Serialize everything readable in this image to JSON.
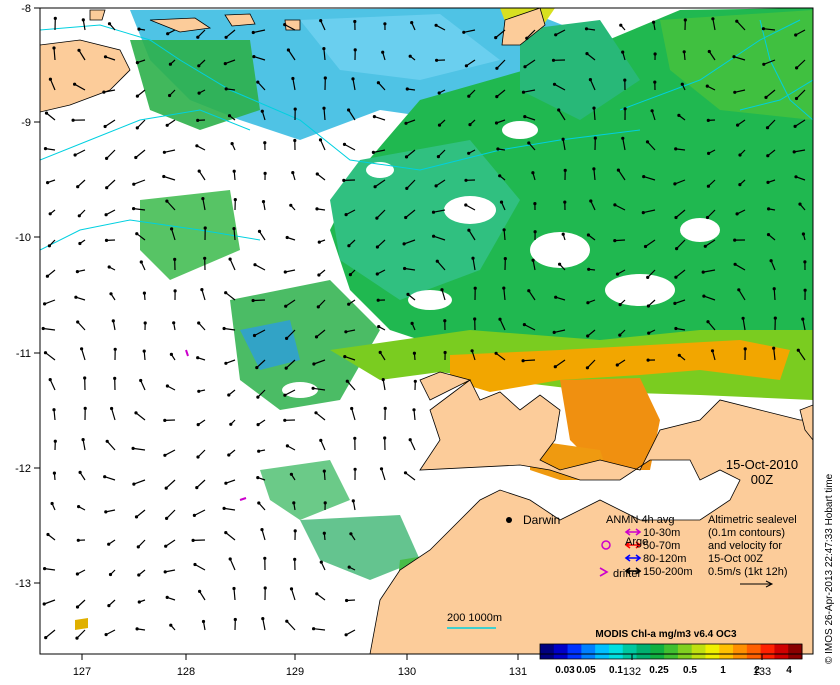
{
  "map": {
    "lon_ticks": [
      "127",
      "128",
      "129",
      "130",
      "131",
      "132",
      "133"
    ],
    "lat_ticks": [
      "-8",
      "-9",
      "-10",
      "-11",
      "-12",
      "-13"
    ],
    "date_line1": "15-Oct-2010",
    "date_line2": "00Z",
    "city": "Darwin",
    "scale_label": "200  1000m",
    "credit": "© IMOS 26-Apr-2013 22:47:33 Hobart time"
  },
  "legend": {
    "anmn_title": "ANMN 4h avg",
    "anmn_items": [
      "10-30m",
      "50-70m",
      "80-120m",
      "150-200m"
    ],
    "anmn_colors": [
      "#cc00cc",
      "#ff0000",
      "#0000ff",
      "#000000"
    ],
    "argo": "Argo",
    "drifter": "drifter",
    "alt_lines": [
      "Altimetric sealevel",
      "(0.1m contours)",
      "and velocity for",
      "15-Oct 00Z",
      "0.5m/s (1kt 12h)"
    ]
  },
  "colorbar": {
    "title": "MODIS Chl-a mg/m3 v6.4 OC3",
    "tick_labels": [
      "0.03",
      "0.05",
      "0.1",
      "0.25",
      "0.5",
      "1",
      "2",
      "4"
    ],
    "colors": [
      "#00007f",
      "#0000c8",
      "#0033ff",
      "#0080ff",
      "#00c0ff",
      "#00e0e0",
      "#00c8a0",
      "#00b070",
      "#10b040",
      "#40c030",
      "#80d020",
      "#c0e010",
      "#f0f000",
      "#ffc000",
      "#ff9000",
      "#ff6000",
      "#ff2000",
      "#d00000",
      "#8a0000"
    ]
  }
}
